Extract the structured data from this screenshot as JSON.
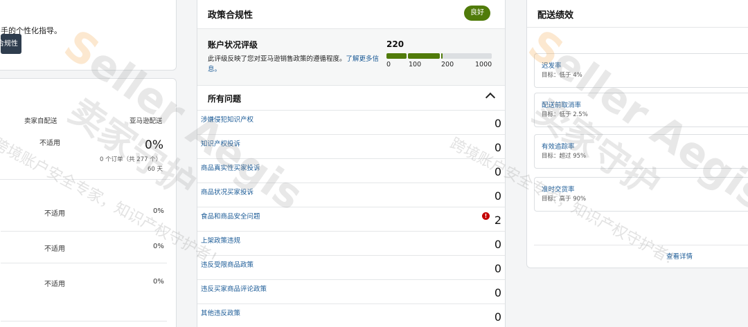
{
  "left_top": {
    "guide_text": "手的个性化指导。",
    "button_label": "合规性"
  },
  "left_main": {
    "col_seller": "卖家自配送",
    "col_amazon": "亚马逊配送",
    "summary": {
      "seller_value": "不适用",
      "amazon_percent": "0%",
      "orders_note": "0 个订单（共 277 个）",
      "days": "60 天"
    },
    "rows": [
      {
        "seller": "不适用",
        "amazon": "0%"
      },
      {
        "seller": "不适用",
        "amazon": "0%"
      },
      {
        "seller": "不适用",
        "amazon": "0%"
      }
    ]
  },
  "policy": {
    "title": "政策合规性",
    "status_badge": "良好",
    "rating": {
      "title": "账户状况评级",
      "description": "此评级反映了您对亚马逊销售政策的遵循程度。",
      "learn_more": "了解更多信息。",
      "score": "220",
      "ticks": [
        "0",
        "100",
        "200",
        "1000"
      ],
      "bar_colors": [
        "#507b0a",
        "#507b0a",
        "#507b0a",
        "#dcdfe2"
      ]
    },
    "issues_title": "所有问题",
    "issues": [
      {
        "label": "涉嫌侵犯知识产权",
        "count": "0"
      },
      {
        "label": "知识产权投诉",
        "count": "0"
      },
      {
        "label": "商品真实性买家投诉",
        "count": "0"
      },
      {
        "label": "商品状况买家投诉",
        "count": "0"
      },
      {
        "label": "食品和商品安全问题",
        "count": "2",
        "alert": "!"
      },
      {
        "label": "上架政策违规",
        "count": "0"
      },
      {
        "label": "违反受限商品政策",
        "count": "0"
      },
      {
        "label": "违反买家商品评论政策",
        "count": "0"
      },
      {
        "label": "其他违反政策",
        "count": "0"
      }
    ]
  },
  "shipping": {
    "title": "配送绩效",
    "metrics": [
      {
        "label": "迟发率",
        "target": "目标：低于 4%"
      },
      {
        "label": "配送前取消率",
        "target": "目标：低于 2.5%"
      },
      {
        "label": "有效追踪率",
        "target": "目标：超过 95%"
      },
      {
        "label": "准时交货率",
        "target": "目标：高于 90%"
      }
    ],
    "view_details": "查看详情"
  },
  "watermark": {
    "brand": "Seller Aegis",
    "brand_first": "S",
    "brand_rest": "eller Aegis",
    "cn": "卖家守护",
    "slogan": "跨境账户安全专家，知识产权守护者！"
  }
}
